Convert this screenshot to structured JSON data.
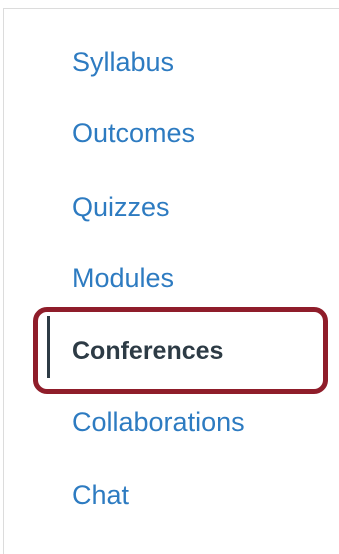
{
  "course_nav": {
    "items": [
      {
        "label": "Syllabus",
        "active": false
      },
      {
        "label": "Outcomes",
        "active": false
      },
      {
        "label": "Quizzes",
        "active": false
      },
      {
        "label": "Modules",
        "active": false
      },
      {
        "label": "Conferences",
        "active": true
      },
      {
        "label": "Collaborations",
        "active": false
      },
      {
        "label": "Chat",
        "active": false
      }
    ]
  },
  "colors": {
    "link": "#2d7bc1",
    "active_text": "#2d3b45",
    "highlight_border": "#8f1d2a"
  }
}
